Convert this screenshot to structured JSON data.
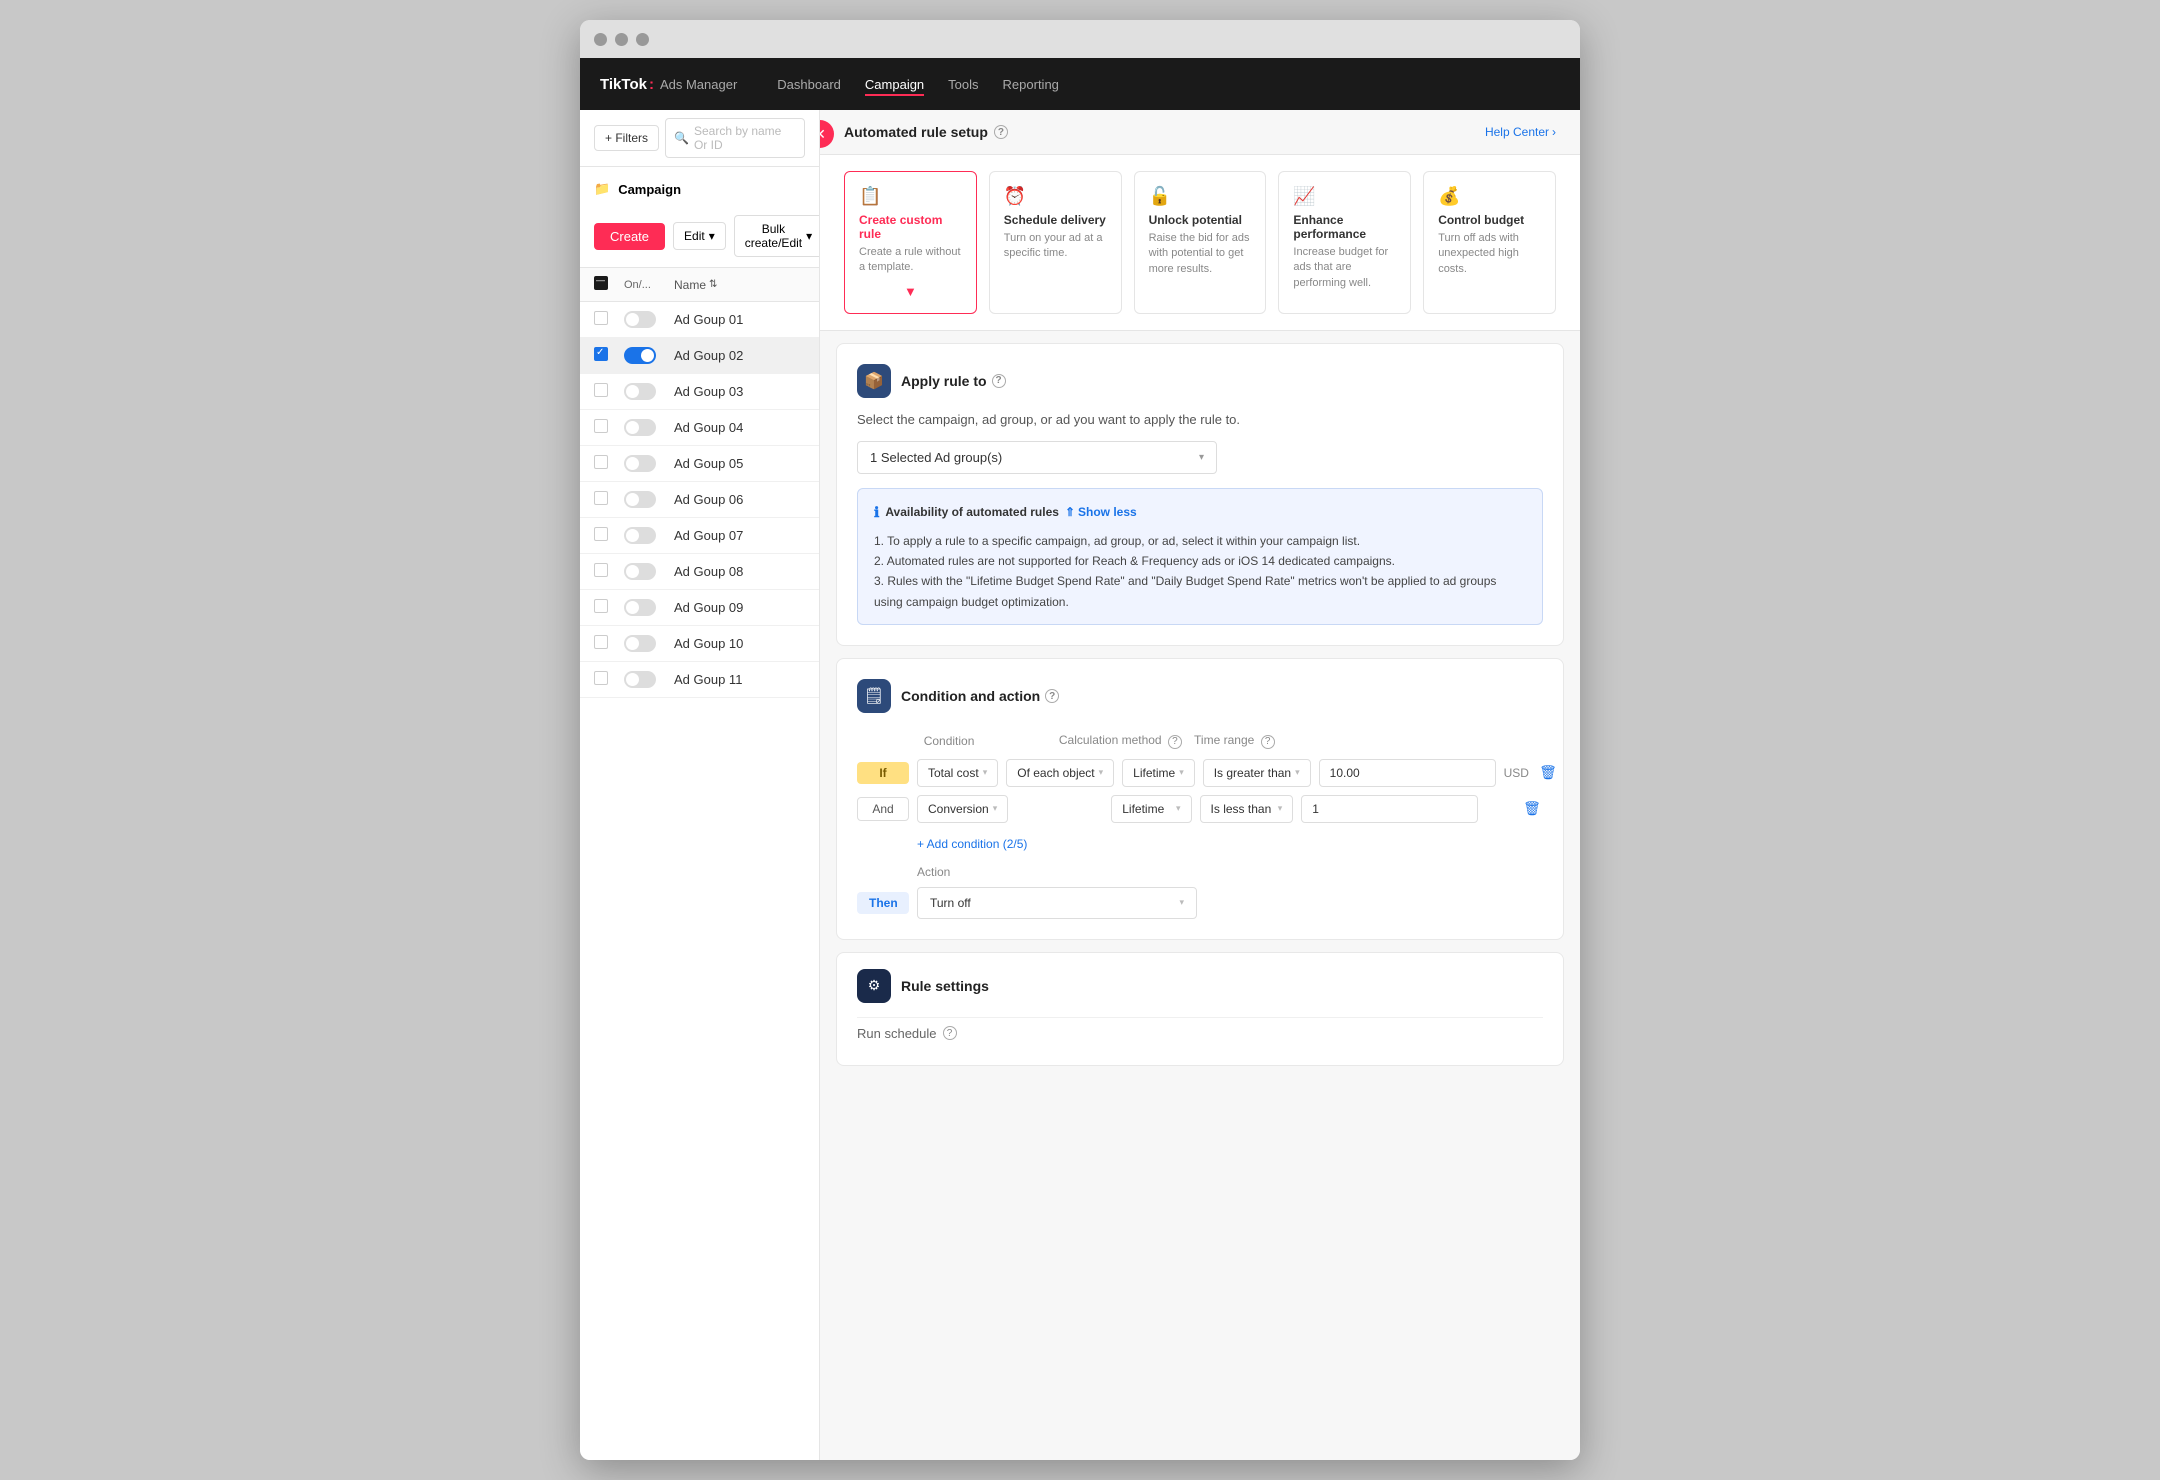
{
  "window": {
    "title": "TikTok Ads Manager"
  },
  "topnav": {
    "brand": "TikTok",
    "colon": ":",
    "product": "Ads Manager",
    "items": [
      {
        "label": "Dashboard",
        "active": false
      },
      {
        "label": "Campaign",
        "active": true
      },
      {
        "label": "Tools",
        "active": false
      },
      {
        "label": "Reporting",
        "active": false
      }
    ]
  },
  "sidebar": {
    "search_placeholder": "Search by name Or ID",
    "filters_label": "+ Filters",
    "folder_icon": "📁",
    "section_label": "Campaign",
    "create_label": "Create",
    "edit_label": "Edit",
    "bulk_label": "Bulk create/Edit",
    "columns": {
      "toggle_label": "On/...",
      "name_label": "Name"
    },
    "items": [
      {
        "name": "Ad Goup 01",
        "on": false,
        "checked": false,
        "active": false
      },
      {
        "name": "Ad Goup 02",
        "on": true,
        "checked": true,
        "active": true
      },
      {
        "name": "Ad Goup 03",
        "on": false,
        "checked": false,
        "active": false
      },
      {
        "name": "Ad Goup 04",
        "on": false,
        "checked": false,
        "active": false
      },
      {
        "name": "Ad Goup 05",
        "on": false,
        "checked": false,
        "active": false
      },
      {
        "name": "Ad Goup 06",
        "on": false,
        "checked": false,
        "active": false
      },
      {
        "name": "Ad Goup 07",
        "on": false,
        "checked": false,
        "active": false
      },
      {
        "name": "Ad Goup 08",
        "on": false,
        "checked": false,
        "active": false
      },
      {
        "name": "Ad Goup 09",
        "on": false,
        "checked": false,
        "active": false
      },
      {
        "name": "Ad Goup 10",
        "on": false,
        "checked": false,
        "active": false
      },
      {
        "name": "Ad Goup 11",
        "on": false,
        "checked": false,
        "active": false
      }
    ]
  },
  "panel": {
    "title": "Automated rule setup",
    "help_link": "Help Center",
    "templates": [
      {
        "id": "custom",
        "icon": "📋",
        "title": "Create custom rule",
        "desc": "Create a rule without a template.",
        "selected": true,
        "arrow": "▼"
      },
      {
        "id": "schedule",
        "icon": "⏰",
        "title": "Schedule delivery",
        "desc": "Turn on your ad at a specific time.",
        "selected": false
      },
      {
        "id": "unlock",
        "icon": "🔓",
        "title": "Unlock potential",
        "desc": "Raise the bid for ads with potential to get more results.",
        "selected": false
      },
      {
        "id": "enhance",
        "icon": "📈",
        "title": "Enhance performance",
        "desc": "Increase budget for ads that are performing well.",
        "selected": false
      },
      {
        "id": "control",
        "icon": "💰",
        "title": "Control budget",
        "desc": "Turn off ads with unexpected high costs.",
        "selected": false
      }
    ],
    "apply_rule": {
      "section_title": "Apply rule to",
      "subtitle": "Select the campaign, ad group, or ad you want to apply the rule to.",
      "selected_value": "1 Selected Ad group(s)",
      "info": {
        "title": "Availability of automated rules",
        "show_less": "Show less",
        "points": [
          "To apply a rule to a specific campaign, ad group, or ad, select it within your campaign list.",
          "Automated rules are not supported for Reach & Frequency ads or iOS 14 dedicated campaigns.",
          "Rules with the \"Lifetime Budget Spend Rate\" and \"Daily Budget Spend Rate\" metrics won't be applied to ad groups using campaign budget optimization."
        ]
      }
    },
    "condition_action": {
      "section_title": "Condition and action",
      "col_condition": "Condition",
      "col_calc": "Calculation method",
      "col_time": "Time range",
      "conditions": [
        {
          "tag": "If",
          "condition": "Total cost",
          "calc": "Of each object",
          "time": "Lifetime",
          "operator": "Is greater than",
          "value": "10.00",
          "currency": "USD"
        },
        {
          "tag": "And",
          "condition": "Conversion",
          "calc": "",
          "time": "Lifetime",
          "operator": "Is less than",
          "value": "1",
          "currency": ""
        }
      ],
      "add_condition": "+ Add condition (2/5)",
      "action": {
        "label": "Action",
        "tag": "Then",
        "value": "Turn off"
      }
    },
    "rule_settings": {
      "title": "Rule settings",
      "run_schedule": "Run schedule"
    }
  }
}
